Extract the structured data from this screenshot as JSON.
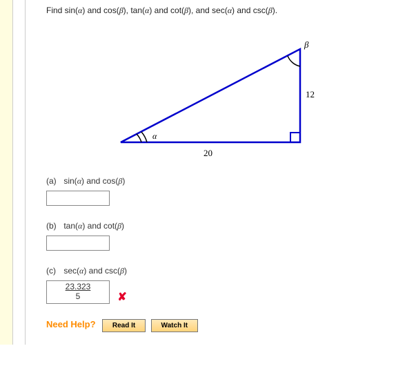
{
  "question": {
    "prefix": "Find sin(",
    "a1": "α",
    "t1": ") and cos(",
    "b1": "β",
    "t2": "), tan(",
    "a2": "α",
    "t3": ") and cot(",
    "b2": "β",
    "t4": "), and sec(",
    "a3": "α",
    "t5": ") and csc(",
    "b3": "β",
    "t6": ")."
  },
  "diagram": {
    "angle_top": "β",
    "angle_left": "α",
    "side_right": "12",
    "side_bottom": "20"
  },
  "parts": {
    "a": {
      "lp": "(a)",
      "f1": "sin(",
      "v1": "α",
      "m": ") and cos(",
      "v2": "β",
      "cl": ")",
      "value": ""
    },
    "b": {
      "lp": "(b)",
      "f1": "tan(",
      "v1": "α",
      "m": ") and cot(",
      "v2": "β",
      "cl": ")",
      "value": ""
    },
    "c": {
      "lp": "(c)",
      "f1": "sec(",
      "v1": "α",
      "m": ") and csc(",
      "v2": "β",
      "cl": ")",
      "num": "23.323",
      "den": "5",
      "wrong": "✘"
    }
  },
  "help": {
    "label": "Need Help?",
    "read": "Read It",
    "watch": "Watch It"
  }
}
